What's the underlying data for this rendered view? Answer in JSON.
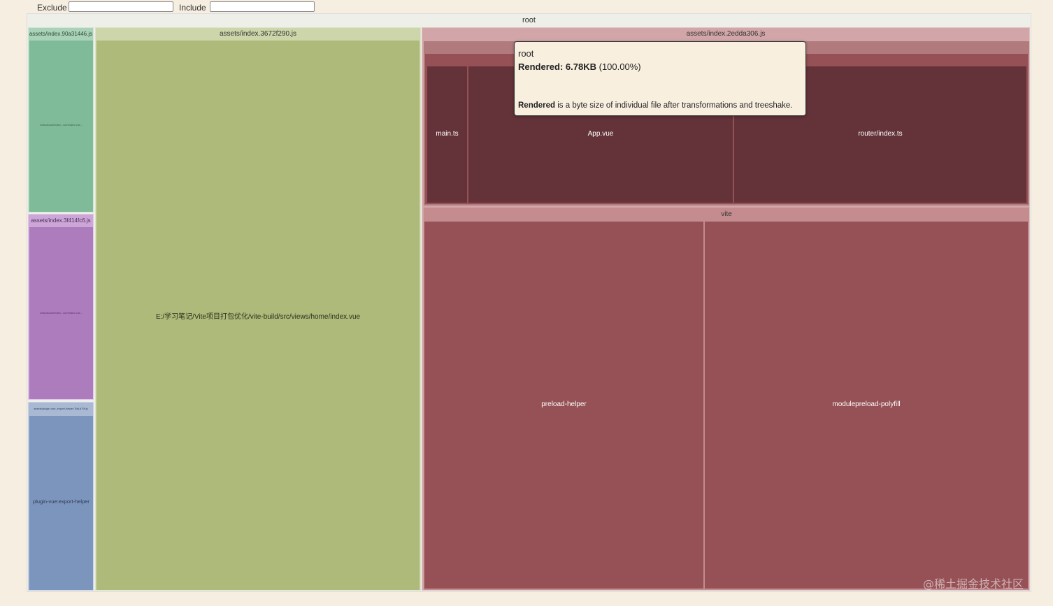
{
  "filters": {
    "exclude_label": "Exclude",
    "exclude_value": "",
    "include_label": "Include",
    "include_value": ""
  },
  "treemap": {
    "root_label": "root",
    "green_bundle": {
      "name": "assets/index.90a31446.js",
      "inner_label": "\\virtual\\vue\\index...vue\\index.vue..."
    },
    "purple_bundle": {
      "name": "assets/index.3f414fc6.js",
      "inner_label": "\\virtual\\vue\\index...vue\\index.vue..."
    },
    "blue_bundle": {
      "name": "assets/plugin-vue_export-helper.7fa1d79f.js",
      "inner_label": "plugin-vue:export-helper"
    },
    "olive_bundle": {
      "name": "assets/index.3672f290.js",
      "inner_label": "E:/学习笔记/Vite项目打包优化/vite-build/src/views/home/index.vue"
    },
    "red_bundle": {
      "name": "assets/index.2edda306.js",
      "src_modules": [
        "main.ts",
        "App.vue",
        "router/index.ts"
      ],
      "vite_label": "vite",
      "vite_modules": [
        "preload-helper",
        "modulepreload-polyfill"
      ]
    }
  },
  "tooltip": {
    "title": "root",
    "rendered_label": "Rendered:",
    "rendered_value": "6.78KB",
    "rendered_percent": "(100.00%)",
    "note_bold": "Rendered",
    "note_text": " is a byte size of individual file after transformations and treeshake."
  },
  "watermark": "@稀土掘金技术社区",
  "colors": {
    "background": "#f6eee0",
    "root_header": "#e5e5e5",
    "green": "#7fbb98",
    "purple": "#ad7cbd",
    "blue": "#7c95bc",
    "olive": "#adba79",
    "red": "#955155",
    "dark_red": "#64333a"
  }
}
